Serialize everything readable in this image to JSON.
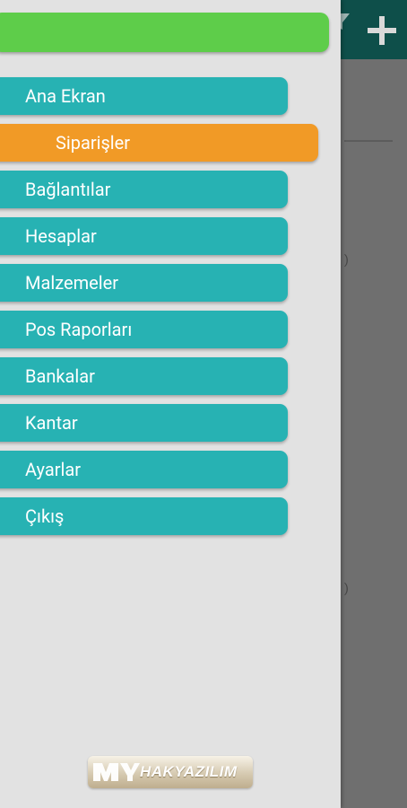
{
  "drawer": {
    "items": [
      {
        "label": "Ana Ekran",
        "active": false
      },
      {
        "label": "Siparişler",
        "active": true
      },
      {
        "label": "Bağlantılar",
        "active": false
      },
      {
        "label": "Hesaplar",
        "active": false
      },
      {
        "label": "Malzemeler",
        "active": false
      },
      {
        "label": "Pos Raporları",
        "active": false
      },
      {
        "label": "Bankalar",
        "active": false
      },
      {
        "label": "Kantar",
        "active": false
      },
      {
        "label": "Ayarlar",
        "active": false
      },
      {
        "label": "Çıkış",
        "active": false
      }
    ]
  },
  "logo": {
    "text": "HAKYAZILIM"
  },
  "colors": {
    "header_green": "#5ecd4a",
    "item_teal": "#27b2b3",
    "active_orange": "#f19a26",
    "drawer_bg": "#e2e2e2",
    "appbar": "#0e4f4a"
  },
  "icons": {
    "appbar_add": "plus-icon",
    "appbar_filter": "filter-icon"
  }
}
